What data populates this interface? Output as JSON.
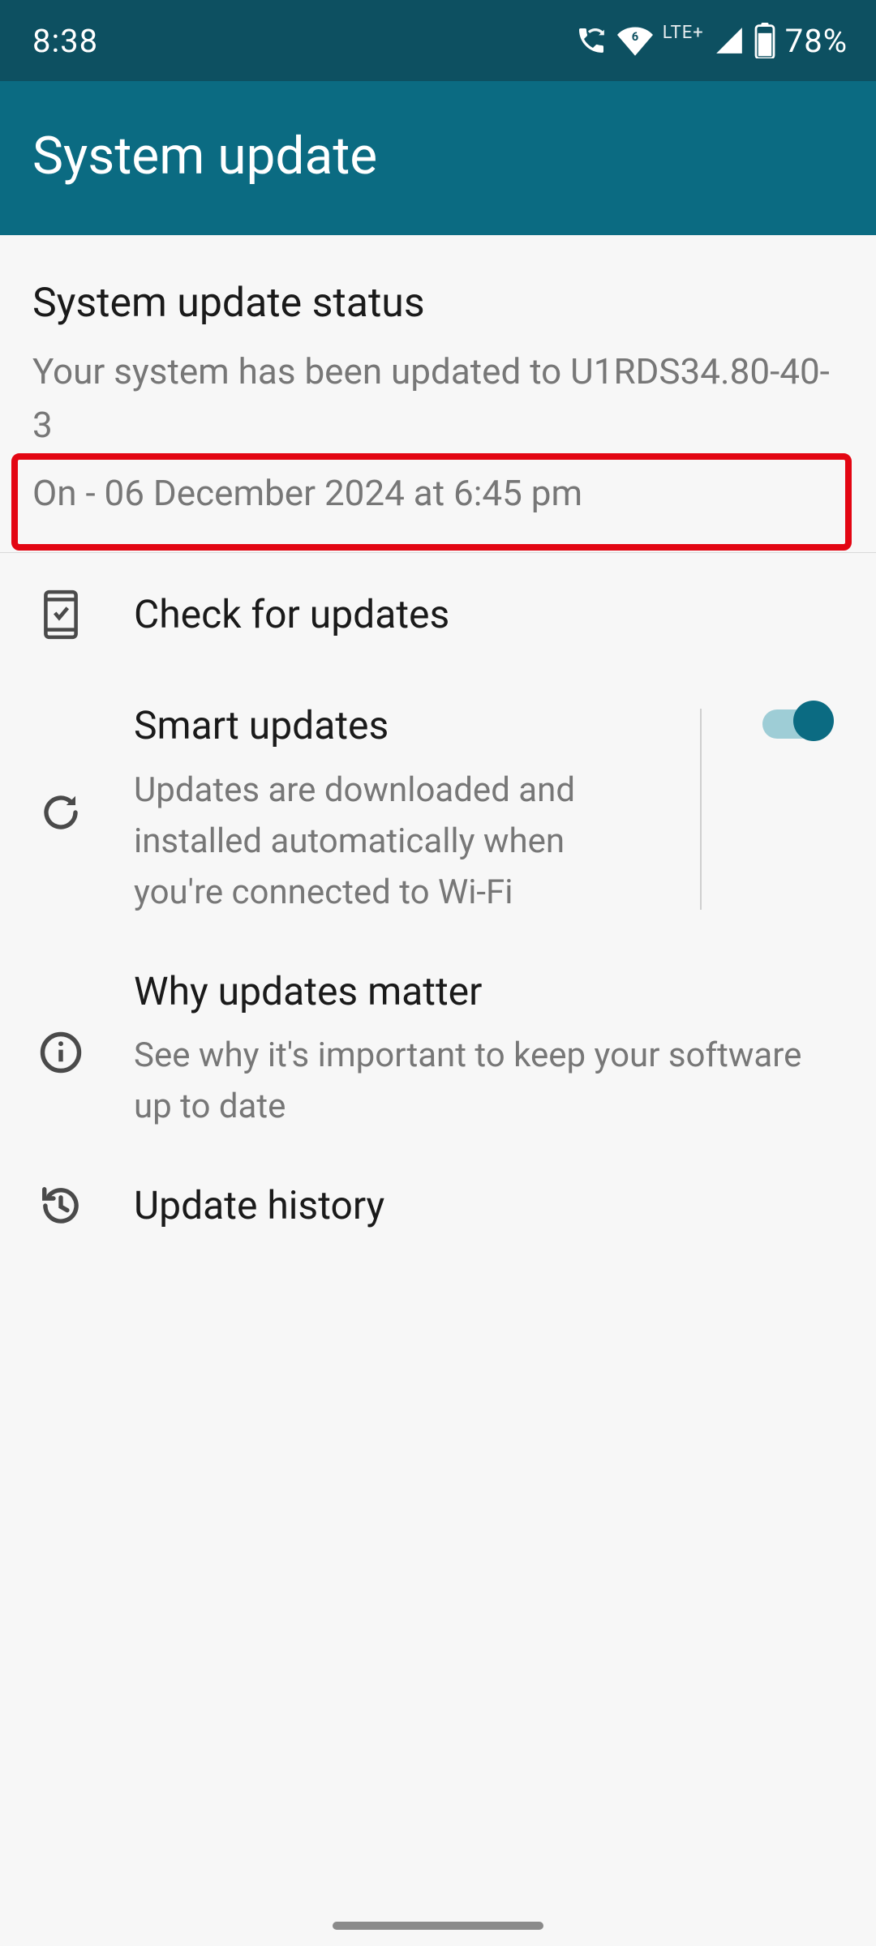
{
  "status_bar": {
    "time": "8:38",
    "network_label": "LTE+",
    "battery_text": "78%"
  },
  "header": {
    "title": "System update"
  },
  "status": {
    "title": "System update status",
    "line1": "Your system has been updated to U1RDS34.80-40-3",
    "line2": "On - 06 December 2024 at 6:45 pm"
  },
  "rows": {
    "check": {
      "title": "Check for updates"
    },
    "smart": {
      "title": "Smart updates",
      "sub": "Updates are downloaded and installed automatically when you're connected to Wi-Fi",
      "toggle_on": true
    },
    "why": {
      "title": "Why updates matter",
      "sub": "See why it's important to keep your software up to date"
    },
    "history": {
      "title": "Update history"
    }
  }
}
